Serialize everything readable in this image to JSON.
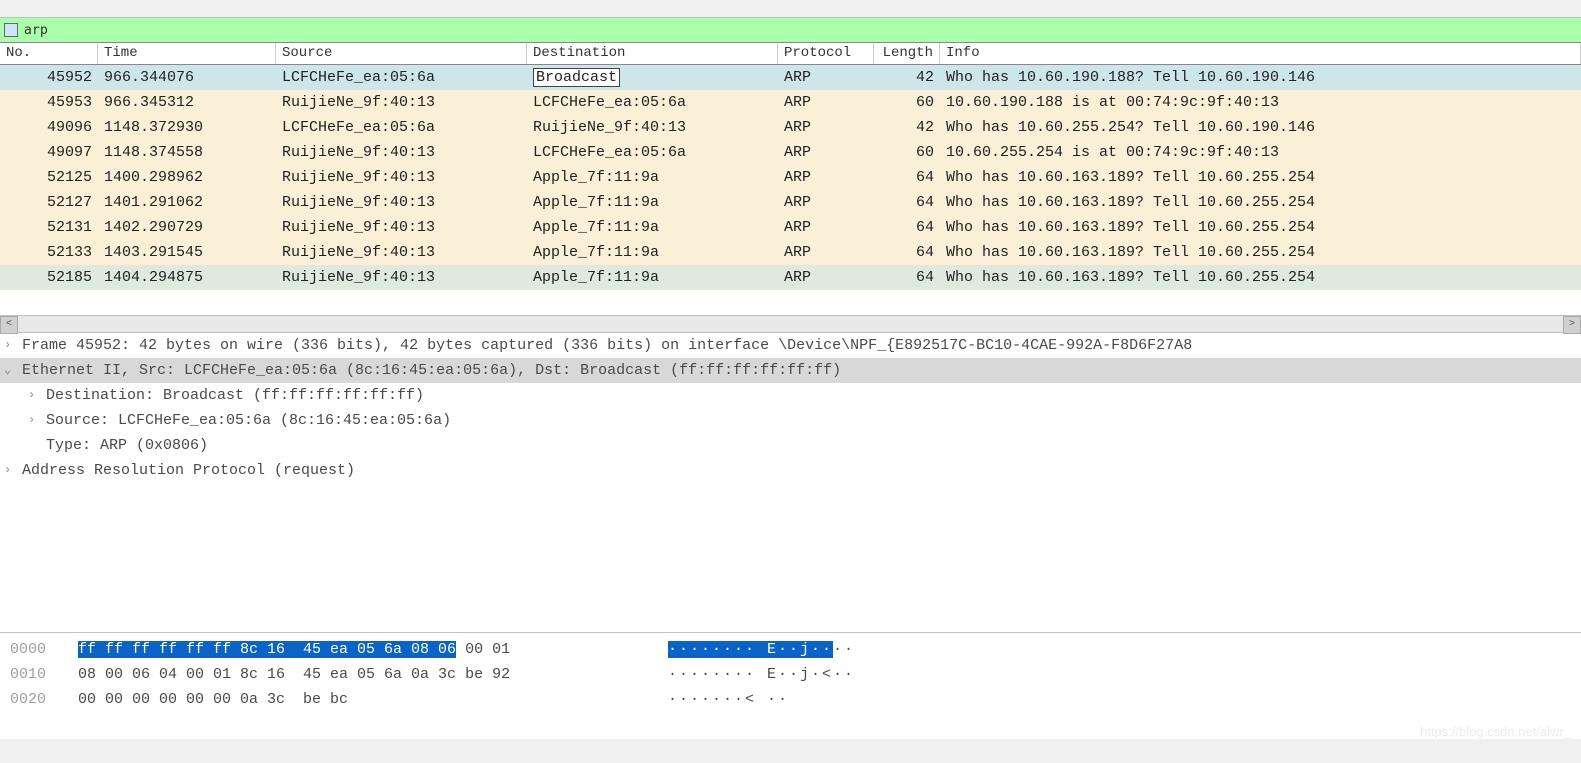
{
  "filter": {
    "value": "arp"
  },
  "columns": {
    "no": "No.",
    "time": "Time",
    "src": "Source",
    "dst": "Destination",
    "proto": "Protocol",
    "len": "Length",
    "info": "Info"
  },
  "packets": [
    {
      "no": "45952",
      "time": "966.344076",
      "src": "LCFCHeFe_ea:05:6a",
      "dst": "Broadcast",
      "proto": "ARP",
      "len": "42",
      "info": "Who has 10.60.190.188? Tell 10.60.190.146",
      "bg": "#cde6e9",
      "sel": true
    },
    {
      "no": "45953",
      "time": "966.345312",
      "src": "RuijieNe_9f:40:13",
      "dst": "LCFCHeFe_ea:05:6a",
      "proto": "ARP",
      "len": "60",
      "info": "10.60.190.188 is at 00:74:9c:9f:40:13",
      "bg": "#faf0d7"
    },
    {
      "no": "49096",
      "time": "1148.372930",
      "src": "LCFCHeFe_ea:05:6a",
      "dst": "RuijieNe_9f:40:13",
      "proto": "ARP",
      "len": "42",
      "info": "Who has 10.60.255.254? Tell 10.60.190.146",
      "bg": "#faf0d7"
    },
    {
      "no": "49097",
      "time": "1148.374558",
      "src": "RuijieNe_9f:40:13",
      "dst": "LCFCHeFe_ea:05:6a",
      "proto": "ARP",
      "len": "60",
      "info": "10.60.255.254 is at 00:74:9c:9f:40:13",
      "bg": "#faf0d7"
    },
    {
      "no": "52125",
      "time": "1400.298962",
      "src": "RuijieNe_9f:40:13",
      "dst": "Apple_7f:11:9a",
      "proto": "ARP",
      "len": "64",
      "info": "Who has 10.60.163.189? Tell 10.60.255.254",
      "bg": "#faf0d7"
    },
    {
      "no": "52127",
      "time": "1401.291062",
      "src": "RuijieNe_9f:40:13",
      "dst": "Apple_7f:11:9a",
      "proto": "ARP",
      "len": "64",
      "info": "Who has 10.60.163.189? Tell 10.60.255.254",
      "bg": "#faf0d7"
    },
    {
      "no": "52131",
      "time": "1402.290729",
      "src": "RuijieNe_9f:40:13",
      "dst": "Apple_7f:11:9a",
      "proto": "ARP",
      "len": "64",
      "info": "Who has 10.60.163.189? Tell 10.60.255.254",
      "bg": "#faf0d7"
    },
    {
      "no": "52133",
      "time": "1403.291545",
      "src": "RuijieNe_9f:40:13",
      "dst": "Apple_7f:11:9a",
      "proto": "ARP",
      "len": "64",
      "info": "Who has 10.60.163.189? Tell 10.60.255.254",
      "bg": "#faf0d7"
    },
    {
      "no": "52185",
      "time": "1404.294875",
      "src": "RuijieNe_9f:40:13",
      "dst": "Apple_7f:11:9a",
      "proto": "ARP",
      "len": "64",
      "info": "Who has 10.60.163.189? Tell 10.60.255.254",
      "bg": "#dfeadf"
    }
  ],
  "details": [
    {
      "lvl": 0,
      "arrow": ">",
      "text": "Frame 45952: 42 bytes on wire (336 bits), 42 bytes captured (336 bits) on interface \\Device\\NPF_{E892517C-BC10-4CAE-992A-F8D6F27A8",
      "hl": false
    },
    {
      "lvl": 0,
      "arrow": "v",
      "text": "Ethernet II, Src: LCFCHeFe_ea:05:6a (8c:16:45:ea:05:6a), Dst: Broadcast (ff:ff:ff:ff:ff:ff)",
      "hl": true
    },
    {
      "lvl": 1,
      "arrow": ">",
      "text": "Destination: Broadcast (ff:ff:ff:ff:ff:ff)",
      "hl": false
    },
    {
      "lvl": 1,
      "arrow": ">",
      "text": "Source: LCFCHeFe_ea:05:6a (8c:16:45:ea:05:6a)",
      "hl": false
    },
    {
      "lvl": 1,
      "arrow": "",
      "text": "Type: ARP (0x0806)",
      "hl": false
    },
    {
      "lvl": 0,
      "arrow": ">",
      "text": "Address Resolution Protocol (request)",
      "hl": false
    }
  ],
  "hex": [
    {
      "offset": "0000",
      "bytes_hl": "ff ff ff ff ff ff 8c 16  45 ea 05 6a 08 06",
      "bytes_rest": " 00 01",
      "ascii_hl": "········ E··j··",
      "ascii_rest": "··"
    },
    {
      "offset": "0010",
      "bytes_hl": "",
      "bytes_rest": "08 00 06 04 00 01 8c 16  45 ea 05 6a 0a 3c be 92",
      "ascii_hl": "",
      "ascii_rest": "········ E··j·<··"
    },
    {
      "offset": "0020",
      "bytes_hl": "",
      "bytes_rest": "00 00 00 00 00 00 0a 3c  be bc",
      "ascii_hl": "",
      "ascii_rest": "·······< ··"
    }
  ],
  "watermark": "https://blog.csdn.net/alwr_"
}
